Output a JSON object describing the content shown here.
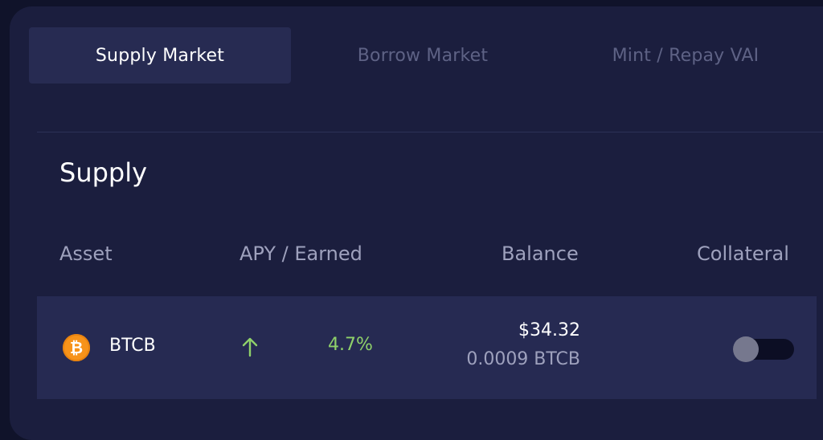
{
  "tabs": [
    {
      "label": "Supply Market",
      "active": true
    },
    {
      "label": "Borrow Market",
      "active": false
    },
    {
      "label": "Mint / Repay VAI",
      "active": false
    }
  ],
  "section": {
    "title": "Supply"
  },
  "table": {
    "columns": [
      "Asset",
      "APY / Earned",
      "Balance",
      "Collateral"
    ],
    "rows": [
      {
        "asset_symbol": "₿",
        "asset": "BTCB",
        "asset_icon": "bitcoin-icon",
        "apy_trend_icon": "arrow-up-icon",
        "apy": "4.7%",
        "balance_usd": "$34.32",
        "balance_token": "0.0009 BTCB",
        "collateral_enabled": false
      }
    ]
  },
  "colors": {
    "background": "#10132a",
    "panel": "#1b1e3e",
    "row": "#262a52",
    "active_tab": "#272b52",
    "positive": "#8fd16a",
    "bitcoin": "#f7931a"
  }
}
